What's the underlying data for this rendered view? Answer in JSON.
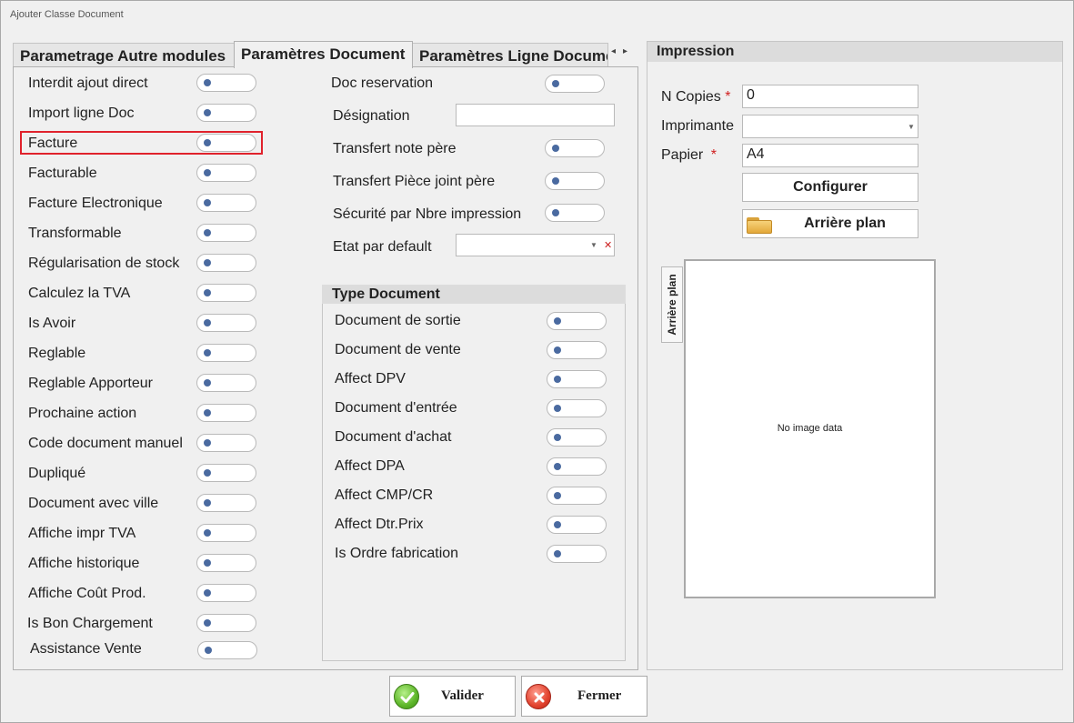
{
  "window": {
    "title": "Ajouter Classe Document"
  },
  "tabs": [
    {
      "label": "Parametrage Autre modules"
    },
    {
      "label": "Paramètres Document"
    },
    {
      "label": "Paramètres Ligne Document"
    }
  ],
  "left_toggles": [
    {
      "label": "Interdit ajout direct"
    },
    {
      "label": "Import ligne Doc"
    },
    {
      "label": "Facture"
    },
    {
      "label": "Facturable"
    },
    {
      "label": "Facture Electronique"
    },
    {
      "label": "Transformable"
    },
    {
      "label": "Régularisation de stock"
    },
    {
      "label": "Calculez la TVA"
    },
    {
      "label": "Is Avoir"
    },
    {
      "label": "Reglable"
    },
    {
      "label": "Reglable Apporteur"
    },
    {
      "label": "Prochaine action"
    },
    {
      "label": "Code document manuel"
    },
    {
      "label": "Dupliqué"
    },
    {
      "label": "Document avec ville"
    },
    {
      "label": "Affiche impr TVA"
    },
    {
      "label": "Affiche historique"
    },
    {
      "label": "Affiche Coût Prod."
    },
    {
      "label": "Is Bon Chargement"
    },
    {
      "label": "Assistance Vente"
    }
  ],
  "middle_fields": {
    "doc_reservation": "Doc reservation",
    "designation": "Désignation",
    "designation_value": "",
    "transfert_note": "Transfert note père",
    "transfert_piece": "Transfert Pièce joint père",
    "securite": "Sécurité par Nbre impression",
    "etat_default": "Etat par default",
    "etat_default_value": ""
  },
  "type_document": {
    "title": "Type Document",
    "items": [
      {
        "label": "Document de sortie"
      },
      {
        "label": "Document de vente"
      },
      {
        "label": "Affect DPV"
      },
      {
        "label": "Document d'entrée"
      },
      {
        "label": "Document d'achat"
      },
      {
        "label": "Affect DPA"
      },
      {
        "label": "Affect CMP/CR"
      },
      {
        "label": "Affect Dtr.Prix"
      },
      {
        "label": "Is Ordre fabrication"
      }
    ]
  },
  "impression": {
    "title": "Impression",
    "copies_label": "N Copies",
    "copies_value": "0",
    "imprimante_label": "Imprimante",
    "imprimante_value": "",
    "papier_label": "Papier",
    "papier_value": "A4",
    "required_mark": "*",
    "configurer_label": "Configurer",
    "arriere_plan_label": "Arrière plan",
    "side_tab_label": "Arrière plan",
    "no_image_text": "No image data"
  },
  "actions": {
    "valider_label": "Valider",
    "fermer_label": "Fermer"
  }
}
